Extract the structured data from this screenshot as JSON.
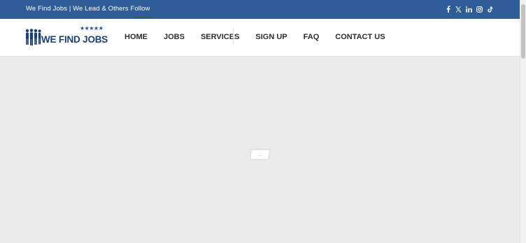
{
  "topbar": {
    "tagline": "We Find Jobs | We Lead & Others Follow",
    "social_icons": [
      "facebook-icon",
      "x-twitter-icon",
      "linkedin-icon",
      "instagram-icon",
      "tiktok-icon"
    ],
    "background_color": "#2f5d97"
  },
  "logo": {
    "text": "WE FIND JOBS",
    "stars": "★★★★★",
    "brand_color": "#1c3f74"
  },
  "nav": {
    "items": [
      {
        "label": "HOME"
      },
      {
        "label": "JOBS"
      },
      {
        "label": "SERVICES"
      },
      {
        "label": "SIGN UP"
      },
      {
        "label": "FAQ"
      },
      {
        "label": "CONTACT US"
      }
    ]
  },
  "content": {
    "loader_indicator": "...",
    "background_color": "#ebebeb"
  }
}
